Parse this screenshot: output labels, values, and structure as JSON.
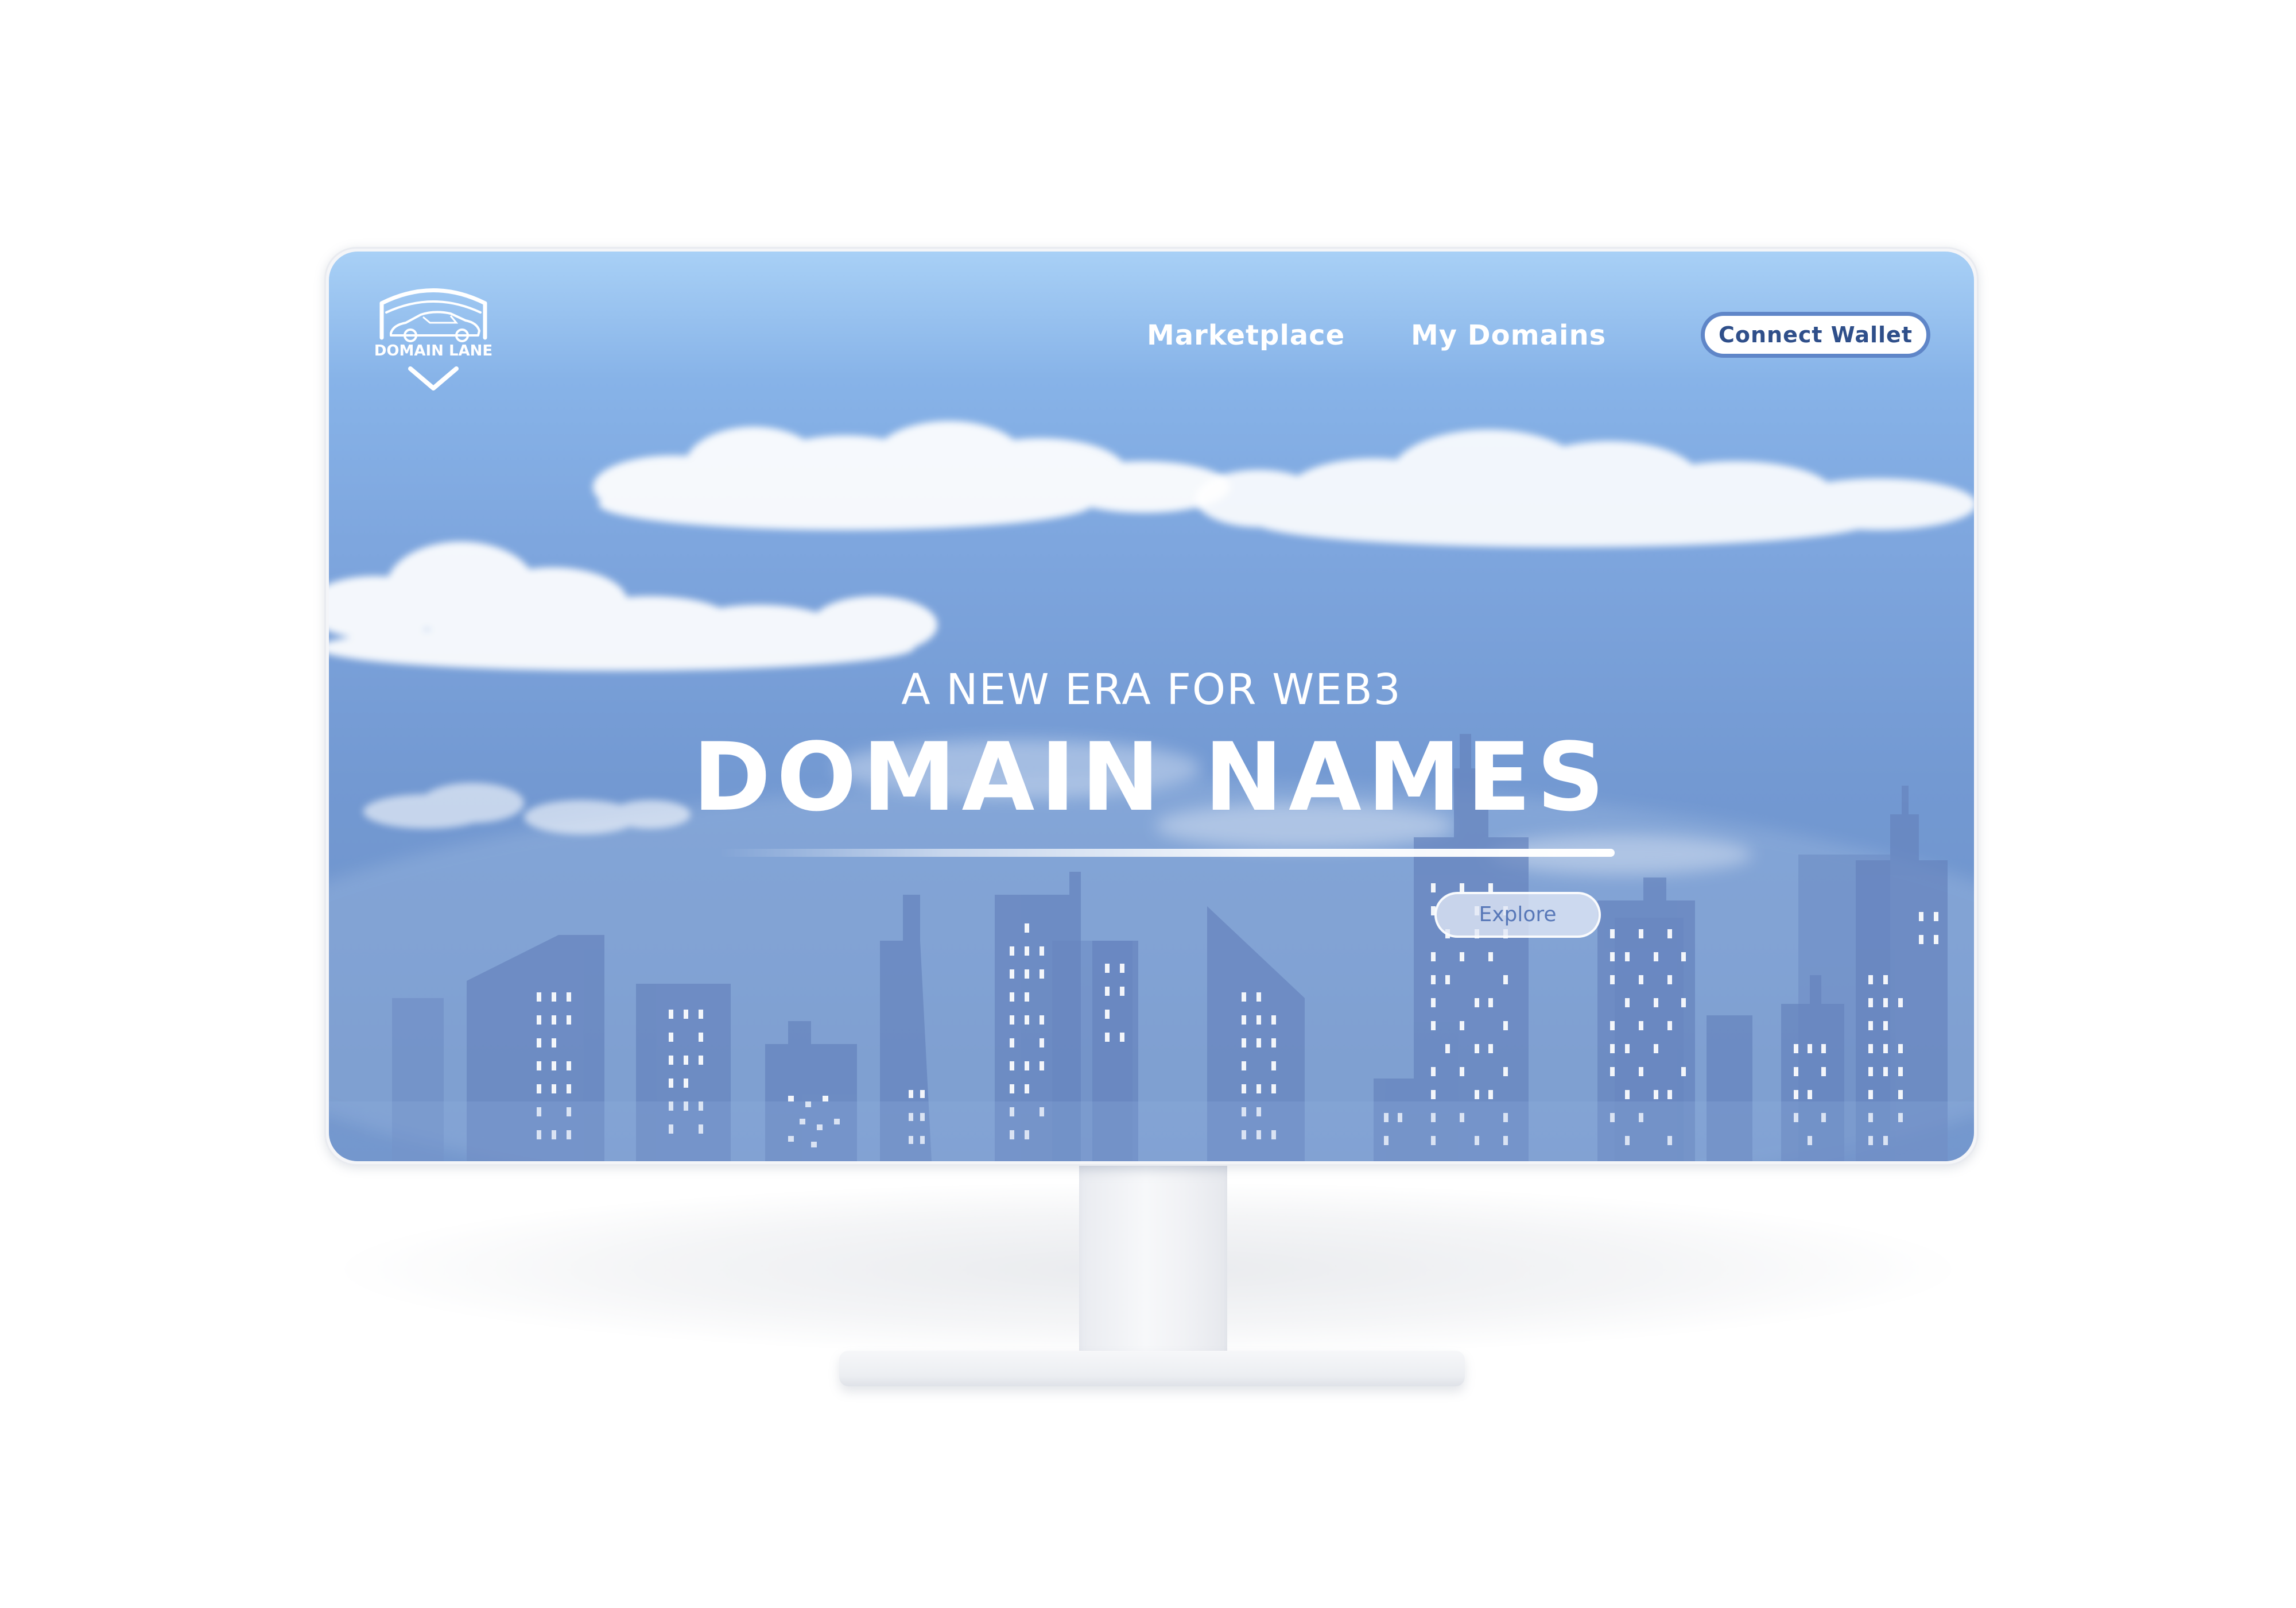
{
  "brand": {
    "logo_text": "DOMAIN LANE"
  },
  "nav": {
    "links": [
      {
        "label": "Marketplace"
      },
      {
        "label": "My Domains"
      }
    ],
    "connect_wallet_label": "Connect Wallet"
  },
  "hero": {
    "tagline": "A NEW ERA FOR WEB3",
    "headline": "DOMAIN NAMES",
    "explore_label": "Explore"
  },
  "icons": [
    "car-shield-logo-icon",
    "chevron-down-icon"
  ],
  "colors": {
    "sky_top": "#a8d0f6",
    "sky_bottom": "#6b8fc7",
    "button_border": "#5f86c8",
    "button_text": "#2f4f8a",
    "explore_text": "#5878b8"
  }
}
